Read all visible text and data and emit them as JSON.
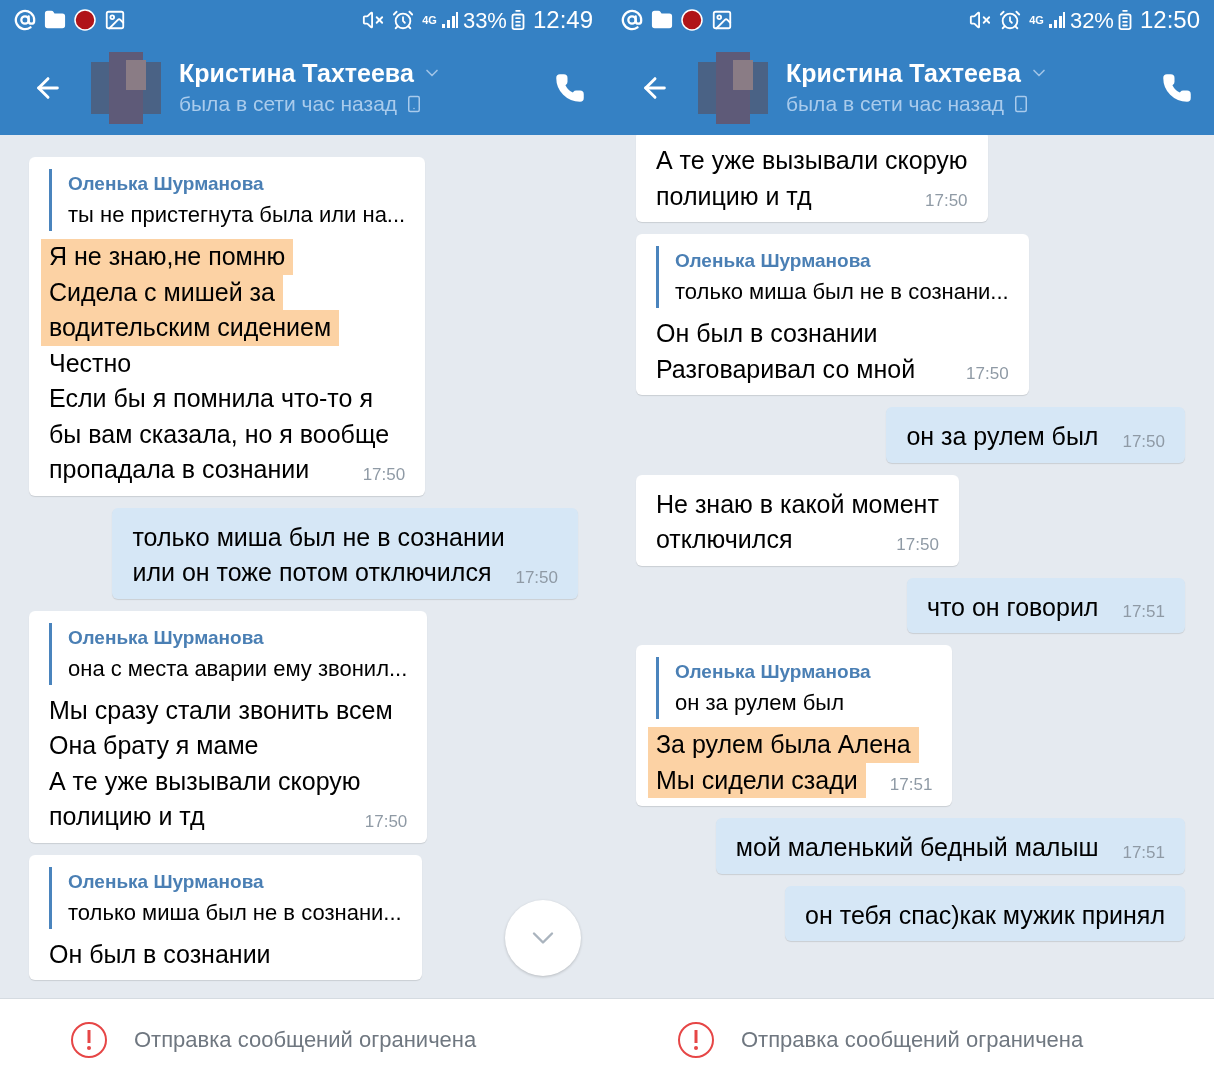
{
  "panes": [
    {
      "status_bar": {
        "network": "4G",
        "battery": "33%",
        "time": "12:49"
      },
      "header": {
        "name": "Кристина Тахтеева",
        "status": "была в сети час назад"
      },
      "messages": [
        {
          "kind": "in",
          "quote": {
            "author": "Оленька Шурманова",
            "text": "ты не пристегнута была или на..."
          },
          "lines": [
            {
              "text": "Я не знаю,не помню",
              "highlighted": true
            },
            {
              "text": "Сидела с мишей за",
              "highlighted": true
            },
            {
              "text": "водительским сидением",
              "highlighted": true
            },
            {
              "text": "Честно",
              "highlighted": false
            },
            {
              "text": "Если бы я помнила что-то я",
              "highlighted": false
            },
            {
              "text": "бы вам сказала, но я вообще",
              "highlighted": false
            },
            {
              "text": "пропадала в сознании",
              "highlighted": false
            }
          ],
          "time": "17:50"
        },
        {
          "kind": "out",
          "lines": [
            {
              "text": "только миша был не в сознании",
              "highlighted": false
            },
            {
              "text": "или он тоже потом отключился",
              "highlighted": false
            }
          ],
          "time": "17:50"
        },
        {
          "kind": "in",
          "quote": {
            "author": "Оленька Шурманова",
            "text": "она с места аварии ему звонил..."
          },
          "lines": [
            {
              "text": "Мы сразу стали звонить всем",
              "highlighted": false
            },
            {
              "text": "Она брату я маме",
              "highlighted": false
            },
            {
              "text": "А те уже вызывали скорую",
              "highlighted": false
            },
            {
              "text": "полицию и тд",
              "highlighted": false
            }
          ],
          "time": "17:50"
        },
        {
          "kind": "in",
          "quote": {
            "author": "Оленька Шурманова",
            "text": "только миша был не в сознани..."
          },
          "lines": [
            {
              "text": "Он был в сознании",
              "highlighted": false
            }
          ]
        }
      ],
      "scroll_down_button": true,
      "footer": {
        "text": "Отправка сообщений ограничена"
      }
    },
    {
      "status_bar": {
        "network": "4G",
        "battery": "32%",
        "time": "12:50"
      },
      "header": {
        "name": "Кристина Тахтеева",
        "status": "была в сети час назад"
      },
      "messages": [
        {
          "kind": "in",
          "lines": [
            {
              "text": "А те уже вызывали скорую",
              "highlighted": false
            },
            {
              "text": "полицию и тд",
              "highlighted": false
            }
          ],
          "time": "17:50"
        },
        {
          "kind": "in",
          "quote": {
            "author": "Оленька Шурманова",
            "text": "только миша был не в сознани..."
          },
          "lines": [
            {
              "text": "Он был в сознании",
              "highlighted": false
            },
            {
              "text": "Разговаривал со мной",
              "highlighted": false
            }
          ],
          "time": "17:50"
        },
        {
          "kind": "out",
          "lines": [
            {
              "text": "он за рулем был",
              "highlighted": false
            }
          ],
          "time": "17:50"
        },
        {
          "kind": "in",
          "lines": [
            {
              "text": "Не знаю в какой момент",
              "highlighted": false
            },
            {
              "text": "отключился",
              "highlighted": false
            }
          ],
          "time": "17:50"
        },
        {
          "kind": "out",
          "lines": [
            {
              "text": "что он говорил",
              "highlighted": false
            }
          ],
          "time": "17:51"
        },
        {
          "kind": "in",
          "quote": {
            "author": "Оленька Шурманова",
            "text": "он за рулем был"
          },
          "lines": [
            {
              "text": "За рулем была Алена",
              "highlighted": true
            },
            {
              "text": "Мы сидели сзади",
              "highlighted": true
            }
          ],
          "time": "17:51"
        },
        {
          "kind": "out",
          "lines": [
            {
              "text": "мой маленький бедный малыш",
              "highlighted": false
            }
          ],
          "time": "17:51"
        },
        {
          "kind": "out",
          "lines": [
            {
              "text": "он тебя спас)как мужик принял",
              "highlighted": false
            }
          ]
        }
      ],
      "footer": {
        "text": "Отправка сообщений ограничена"
      }
    }
  ]
}
